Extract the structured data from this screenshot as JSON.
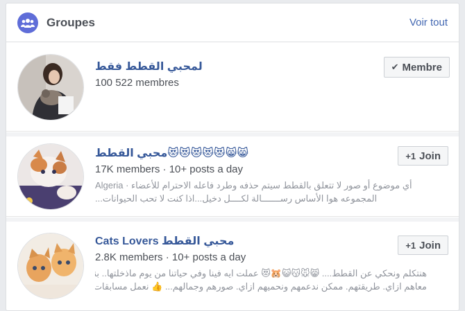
{
  "header": {
    "title": "Groupes",
    "see_all": "Voir tout"
  },
  "groups": [
    {
      "name": "لمحبي القطط فقط",
      "meta": "100 522 membres",
      "button_label": "Membre",
      "button_icon": "check-icon"
    },
    {
      "name": "محبي القطط😻😻😻😻😻😸😸",
      "meta": "17K members · 10+ posts a day",
      "desc_line1": "أي موضوع أو صور لا تتعلق بالقطط سيتم حذفه وطرد فاعله الاحترام للأعضاء · Algeria",
      "desc_line2": "المجموعه هوا الأساس رســـــــالة لكــــل دخيل...اذا كنت لا تحب الحيوانات...",
      "button_label": "Join",
      "button_icon": "add-friend-icon"
    },
    {
      "name": "Cats Lovers محبي القطط",
      "meta": "2.8K members · 10+ posts a day",
      "desc_line1": "هنتكلم ونحكي عن القطط.... 😸🐭😽😺🐹😻 عملت ايه فينا وفي حياتنا من يوم ماذخلتها.. بنتعامل",
      "desc_line2": "معاهم ازاي. طريقتهم. ممكن ندعمهم ونحميهم ازاي. صورهم وجمالهم... 👍 نعمل مسابقات ونعمل زي",
      "button_label": "Join",
      "button_icon": "add-friend-icon"
    }
  ]
}
